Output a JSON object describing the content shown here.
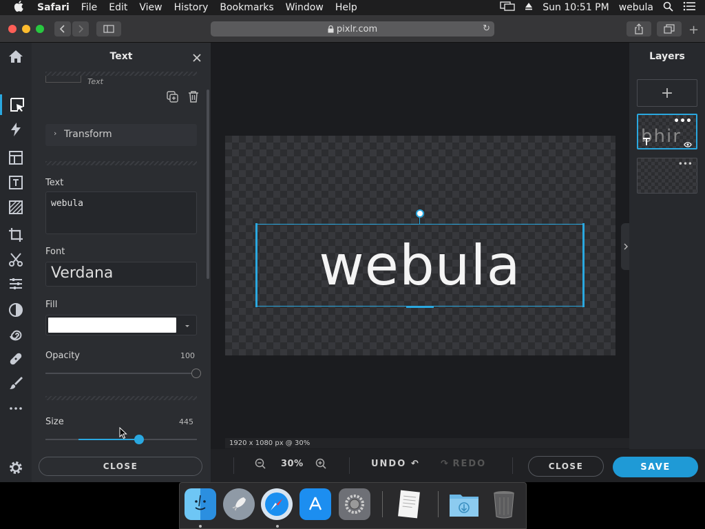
{
  "menubar": {
    "app_name": "Safari",
    "items": [
      "File",
      "Edit",
      "View",
      "History",
      "Bookmarks",
      "Window",
      "Help"
    ],
    "clock": "Sun 10:51 PM",
    "user": "webula"
  },
  "browser": {
    "url": "pixlr.com"
  },
  "text_panel": {
    "title": "Text",
    "layer_caption": "Text",
    "transform_label": "Transform",
    "text_label": "Text",
    "text_value": "webula",
    "font_label": "Font",
    "font_value": "Verdana",
    "fill_label": "Fill",
    "fill_color": "#ffffff",
    "opacity_label": "Opacity",
    "opacity_value": "100",
    "opacity_level": 1.0,
    "size_label": "Size",
    "size_value": "445",
    "size_level": 0.62,
    "close_label": "CLOSE"
  },
  "canvas": {
    "text": "webula",
    "status": "1920 x 1080 px @ 30%"
  },
  "bottom_bar": {
    "zoom": "30%",
    "undo": "UNDO",
    "redo": "REDO",
    "close": "CLOSE",
    "save": "SAVE"
  },
  "layers_panel": {
    "title": "Layers",
    "layer1_preview": "bhir"
  },
  "colors": {
    "accent": "#2aa8e0",
    "save_button": "#1f9ad6"
  },
  "dock": {
    "apps": [
      "Finder",
      "Launchpad",
      "Safari",
      "App Store",
      "System Preferences",
      "TextEdit",
      "Downloads",
      "Trash"
    ]
  }
}
